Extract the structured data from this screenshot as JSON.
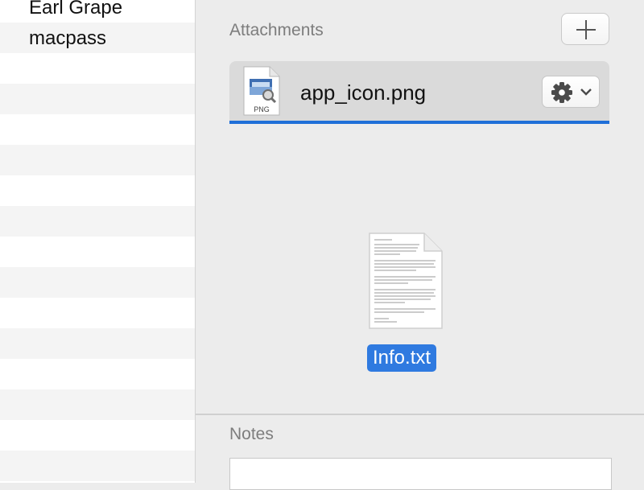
{
  "entries_list": {
    "items": [
      {
        "label": "Earl Grape"
      },
      {
        "label": "macpass"
      }
    ]
  },
  "attachments": {
    "section_title": "Attachments",
    "add_icon": "plus-icon",
    "files": [
      {
        "name": "app_icon.png",
        "type_badge": "PNG",
        "icon": "png-file-icon"
      }
    ],
    "actions_icon": "gear-icon",
    "dropped_file": {
      "name": "Info.txt",
      "icon": "text-document-icon"
    }
  },
  "notes": {
    "section_title": "Notes"
  },
  "colors": {
    "selection_blue": "#2f7ae0",
    "underline_blue": "#1f6fd8"
  }
}
